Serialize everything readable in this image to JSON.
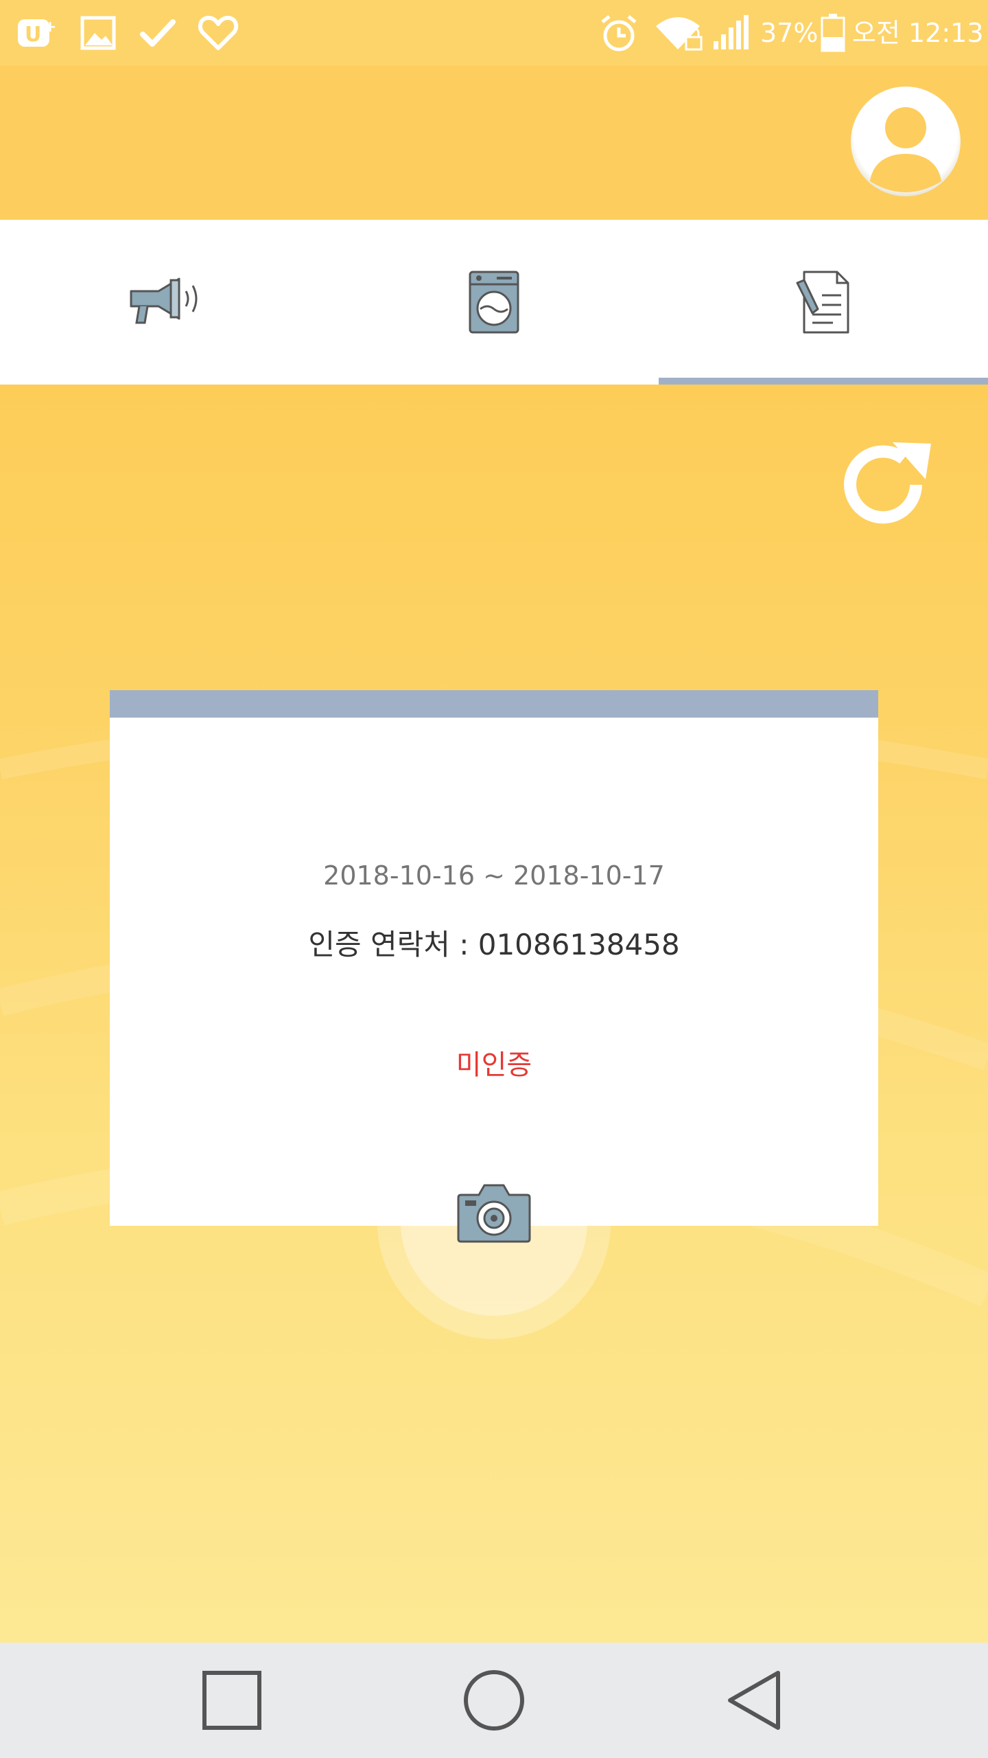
{
  "status_bar": {
    "battery_percent": "37%",
    "time": "오전 12:13",
    "left_icons": [
      "uplus-icon",
      "gallery-icon",
      "check-icon",
      "heart-icon"
    ],
    "right_icons": [
      "alarm-icon",
      "wifi-lock-icon",
      "signal-icon",
      "battery-icon"
    ]
  },
  "header": {
    "profile_icon": "profile-avatar-icon"
  },
  "tabs": [
    {
      "icon": "megaphone-icon",
      "selected": false
    },
    {
      "icon": "washing-machine-icon",
      "selected": false
    },
    {
      "icon": "document-icon",
      "selected": true
    }
  ],
  "card": {
    "date_range": "2018-10-16 ~ 2018-10-17",
    "contact_label": "인증 연락처 :",
    "contact_value": "01086138458",
    "status": "미인증",
    "status_color": "#e53935"
  },
  "colors": {
    "primary_yellow": "#fdcd5e",
    "accent_gray_blue": "#a0b1c7"
  },
  "nav": {
    "recents_icon": "recents-square-icon",
    "home_icon": "home-circle-icon",
    "back_icon": "back-triangle-icon"
  }
}
